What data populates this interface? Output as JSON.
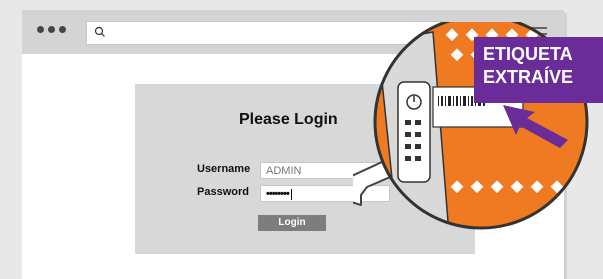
{
  "browser": {
    "address_bar": {
      "value": "",
      "icon": "search-icon"
    }
  },
  "login": {
    "title": "Please Login",
    "username_label": "Username",
    "username_value": "ADMIN",
    "password_label": "Password",
    "password_value": "••••••••",
    "button_label": "Login"
  },
  "callout": {
    "line1": "ETIQUETA",
    "line2": "EXTRAÍVE"
  },
  "colors": {
    "accent_purple": "#6a2c99",
    "device_orange": "#f07a22",
    "panel_gray": "#d8d8d8"
  }
}
